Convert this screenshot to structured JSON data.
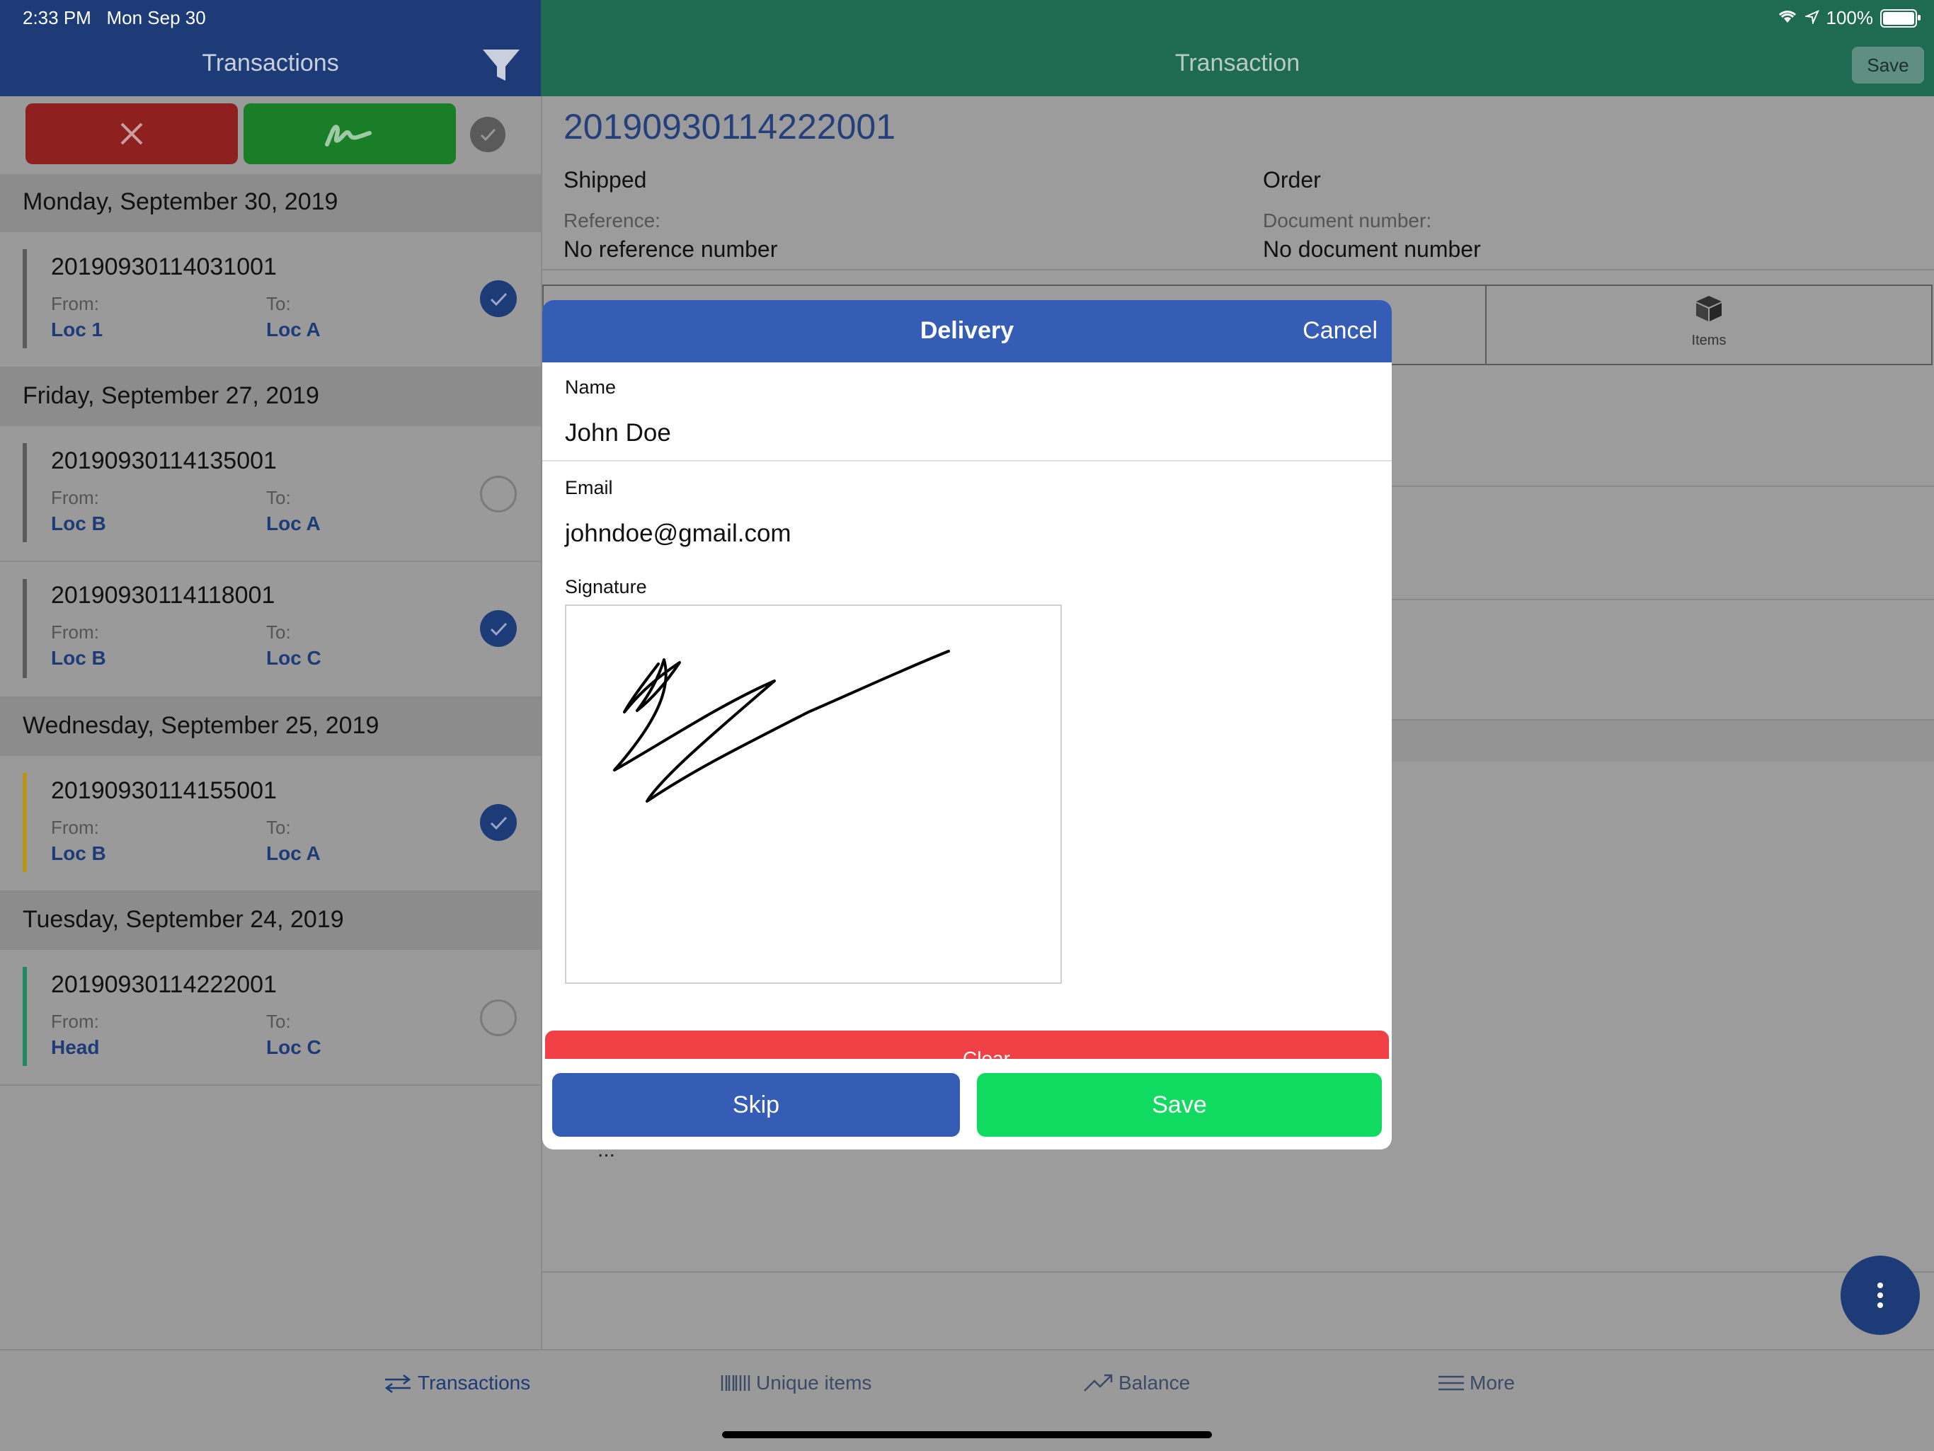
{
  "status": {
    "time": "2:33 PM",
    "date": "Mon Sep 30",
    "battery": "100%"
  },
  "left_header": {
    "title": "Transactions"
  },
  "right_header": {
    "title": "Transaction",
    "save_label": "Save"
  },
  "groups": [
    {
      "date": "Monday, September 30, 2019",
      "items": [
        {
          "id": "20190930114031001",
          "from_label": "From:",
          "from": "Loc 1",
          "to_label": "To:",
          "to": "Loc A"
        }
      ]
    },
    {
      "date": "Friday, September 27, 2019",
      "items": [
        {
          "id": "20190930114135001",
          "from_label": "From:",
          "from": "Loc B",
          "to_label": "To:",
          "to": "Loc A"
        },
        {
          "id": "20190930114118001",
          "from_label": "From:",
          "from": "Loc B",
          "to_label": "To:",
          "to": "Loc C"
        }
      ]
    },
    {
      "date": "Wednesday, September 25, 2019",
      "items": [
        {
          "id": "20190930114155001",
          "from_label": "From:",
          "from": "Loc B",
          "to_label": "To:",
          "to": "Loc A"
        }
      ]
    },
    {
      "date": "Tuesday, September 24, 2019",
      "items": [
        {
          "id": "20190930114222001",
          "from_label": "From:",
          "from": "Head",
          "to_label": "To:",
          "to": "Loc C"
        }
      ]
    }
  ],
  "detail": {
    "id": "20190930114222001",
    "status": "Shipped",
    "type": "Order",
    "reference_label": "Reference:",
    "reference": "No reference number",
    "document_label": "Document number:",
    "document": "No document number",
    "items_tab": "Items"
  },
  "modal": {
    "title": "Delivery",
    "cancel": "Cancel",
    "name_label": "Name",
    "name": "John Doe",
    "email_label": "Email",
    "email": "johndoe@gmail.com",
    "signature_label": "Signature",
    "clear": "Clear",
    "skip": "Skip",
    "save": "Save"
  },
  "ellipsis": "...",
  "tabbar": {
    "transactions": "Transactions",
    "unique_items": "Unique items",
    "balance": "Balance",
    "more": "More"
  },
  "colors": {
    "left_header": "#1d3b77",
    "right_header": "#1f6b52",
    "modal_header": "#365db5",
    "save_green": "#10da5f",
    "clear_red": "#ef4045",
    "reject_red": "#8e2020",
    "sign_green": "#1a7d27"
  }
}
